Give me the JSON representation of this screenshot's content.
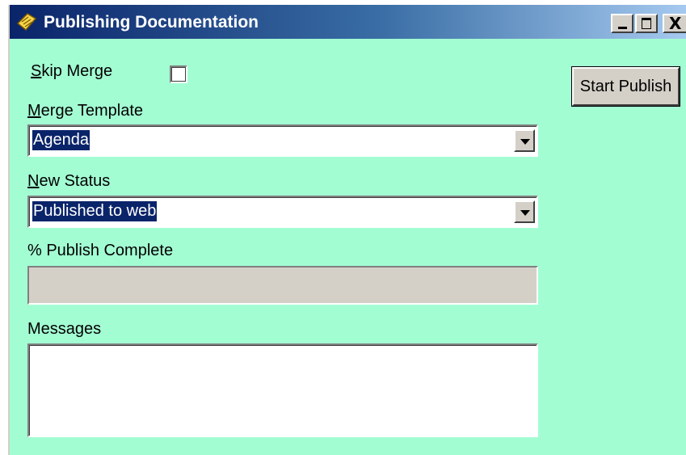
{
  "window": {
    "title": "Publishing Documentation",
    "background_color": "#a3fdd3",
    "titlebar_color": "#0a246a",
    "controls": {
      "minimize_icon": "minimize-icon",
      "maximize_icon": "maximize-icon",
      "close_icon": "close-icon",
      "close_glyph": "X"
    }
  },
  "form": {
    "skip_merge": {
      "accel": "S",
      "label_rest": "kip Merge",
      "checked": false
    },
    "merge_template": {
      "accel": "M",
      "label_rest": "erge Template",
      "value": "Agenda"
    },
    "new_status": {
      "accel": "N",
      "label_rest": "ew Status",
      "value": "Published to web"
    },
    "publish_complete": {
      "label": "% Publish Complete",
      "progress": 0
    },
    "messages": {
      "label": "Messages",
      "value": ""
    },
    "start_publish_label": "Start Publish"
  }
}
